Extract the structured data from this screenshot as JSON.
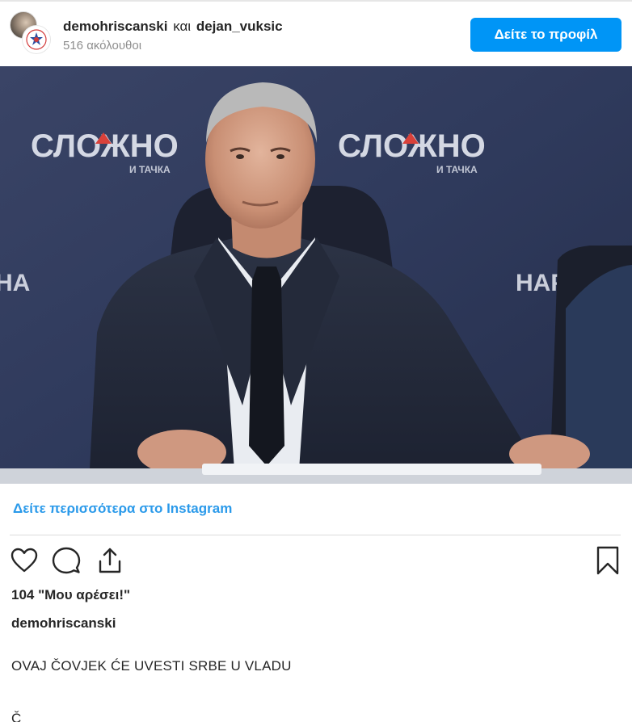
{
  "header": {
    "user_primary": "demohriscanski",
    "connector": "και",
    "user_secondary": "dejan_vuksic",
    "followers": "516 ακόλουθοι",
    "profile_button": "Δείτε το προφίλ"
  },
  "photo": {
    "backdrop_text_left": "СЛОЖНО",
    "backdrop_sub_left": "И ТАЧКА",
    "backdrop_text_right": "СЛОЖНО",
    "backdrop_sub_right": "И ТАЧКА",
    "backdrop_edge_left": "НА",
    "backdrop_edge_right": "НАР"
  },
  "more_link": "Δείτε περισσότερα στο Instagram",
  "actions": {
    "icons": [
      "heart-icon",
      "comment-icon",
      "share-icon",
      "bookmark-icon"
    ]
  },
  "likes": "104 \"Μου αρέσει!\"",
  "caption": {
    "username": "demohriscanski",
    "text": "OVAJ ČOVJEK ĆE UVESTI SRBE U VLADU",
    "more": "Č"
  },
  "colors": {
    "button_blue": "#0095f6",
    "link_blue": "#2b9aea",
    "text": "#262626",
    "muted": "#8e8e8e",
    "backdrop": "#2e3856"
  }
}
